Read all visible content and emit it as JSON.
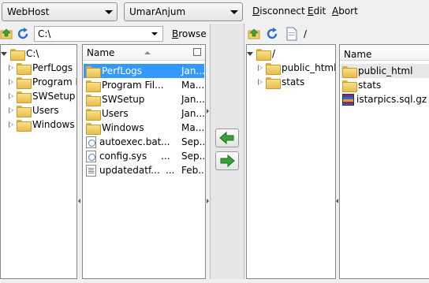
{
  "top": {
    "site_combo": "WebHost",
    "user_combo": "UmarAnjum",
    "menu": {
      "disconnect": "Disconnect",
      "edit": "Edit",
      "abort": "Abort"
    }
  },
  "local": {
    "path": "C:\\",
    "browse_label": "Browse",
    "tree": {
      "root": "C:\\",
      "items": [
        "PerfLogs",
        "Program Fi",
        "SWSetup",
        "Users",
        "Windows"
      ]
    },
    "list": {
      "column_name": "Name",
      "rows": [
        {
          "name": "PerfLogs",
          "date": "Jan...",
          "icon": "folder-icon",
          "selected": true
        },
        {
          "name": "Program Fil...",
          "date": "Ma...",
          "icon": "folder-icon"
        },
        {
          "name": "SWSetup",
          "date": "Jan...",
          "icon": "folder-icon"
        },
        {
          "name": "Users",
          "date": "Jan...",
          "icon": "folder-icon"
        },
        {
          "name": "Windows",
          "date": "Ma...",
          "icon": "folder-icon"
        },
        {
          "name": "autoexec.bat",
          "date": "Sep...",
          "icon": "system-file-icon"
        },
        {
          "name": "config.sys",
          "date": "Sep...",
          "icon": "system-file-icon"
        },
        {
          "name": "updatedatf...",
          "date": "Feb...",
          "icon": "text-file-icon"
        }
      ],
      "row_marker": "..."
    }
  },
  "remote": {
    "path": "/",
    "tree": {
      "root": "/",
      "items": [
        "public_html",
        "stats"
      ]
    },
    "list": {
      "column_name": "Name",
      "rows": [
        {
          "name": "public_html",
          "icon": "folder-icon"
        },
        {
          "name": "stats",
          "icon": "folder-icon"
        },
        {
          "name": "istarpics.sql.gz",
          "icon": "archive-icon"
        }
      ]
    }
  },
  "colors": {
    "selection": "#3399ff",
    "transfer_arrow": "#3aa13a"
  }
}
